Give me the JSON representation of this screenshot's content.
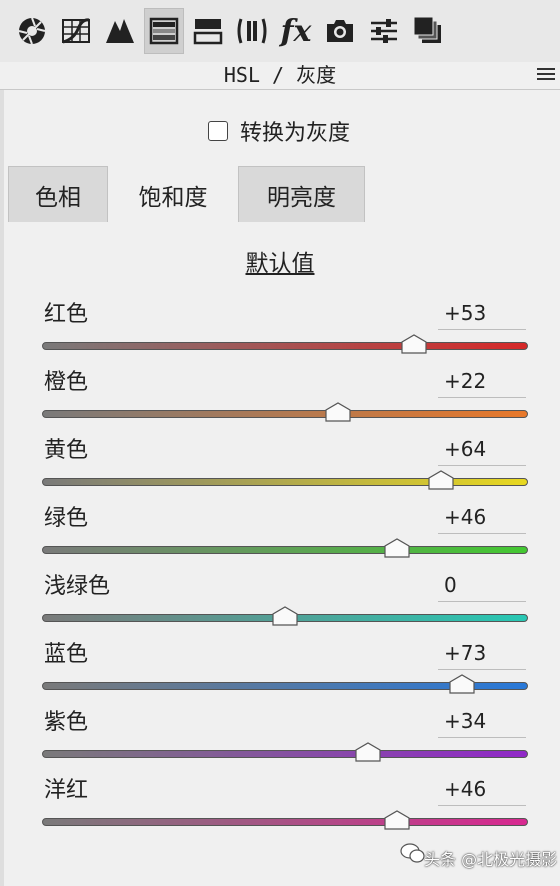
{
  "toolbar": {
    "tools": [
      {
        "icon": "aperture-icon"
      },
      {
        "icon": "tone-curve-icon"
      },
      {
        "icon": "detail-icon"
      },
      {
        "icon": "hsl-icon",
        "active": true
      },
      {
        "icon": "split-toning-icon"
      },
      {
        "icon": "lens-correction-icon"
      },
      {
        "icon": "effects-icon",
        "text": "fx"
      },
      {
        "icon": "camera-calibration-icon"
      },
      {
        "icon": "presets-icon"
      },
      {
        "icon": "snapshots-icon"
      }
    ]
  },
  "header": {
    "title": "HSL / 灰度"
  },
  "gray": {
    "label": "转换为灰度",
    "checked": false
  },
  "tabs": [
    {
      "label": "色相",
      "active": false
    },
    {
      "label": "饱和度",
      "active": true
    },
    {
      "label": "明亮度",
      "active": false
    }
  ],
  "default_label": "默认值",
  "sliders": [
    {
      "label": "红色",
      "value": "+53",
      "amount": 53,
      "color": "#d62828"
    },
    {
      "label": "橙色",
      "value": "+22",
      "amount": 22,
      "color": "#e8782a"
    },
    {
      "label": "黄色",
      "value": "+64",
      "amount": 64,
      "color": "#e8d820"
    },
    {
      "label": "绿色",
      "value": "+46",
      "amount": 46,
      "color": "#44c832"
    },
    {
      "label": "浅绿色",
      "value": "0",
      "amount": 0,
      "color": "#28c8b4"
    },
    {
      "label": "蓝色",
      "value": "+73",
      "amount": 73,
      "color": "#2878d8"
    },
    {
      "label": "紫色",
      "value": "+34",
      "amount": 34,
      "color": "#9028c8"
    },
    {
      "label": "洋红",
      "value": "+46",
      "amount": 46,
      "color": "#d82890"
    }
  ],
  "watermark": {
    "text": "头条 @北极光摄影"
  }
}
